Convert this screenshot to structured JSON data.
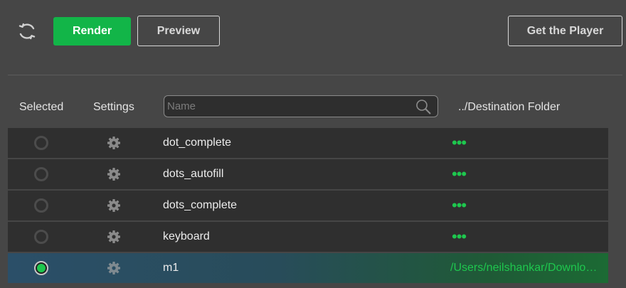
{
  "toolbar": {
    "render_label": "Render",
    "preview_label": "Preview",
    "player_label": "Get the Player",
    "refresh_icon": "refresh-icon"
  },
  "header": {
    "selected_label": "Selected",
    "settings_label": "Settings",
    "search_placeholder": "Name",
    "destination_label": "../Destination Folder"
  },
  "rows": [
    {
      "name": "dot_complete",
      "selected": false,
      "destination": "•••"
    },
    {
      "name": "dots_autofill",
      "selected": false,
      "destination": "•••"
    },
    {
      "name": "dots_complete",
      "selected": false,
      "destination": "•••"
    },
    {
      "name": "keyboard",
      "selected": false,
      "destination": "•••"
    },
    {
      "name": "m1",
      "selected": true,
      "destination": "/Users/neilshankar/Downloads"
    }
  ],
  "colors": {
    "accent": "#12b548",
    "background": "#464646",
    "row": "#2f2f2f",
    "selected_row_start": "#2b4f68",
    "selected_row_end": "#1c6a34"
  }
}
